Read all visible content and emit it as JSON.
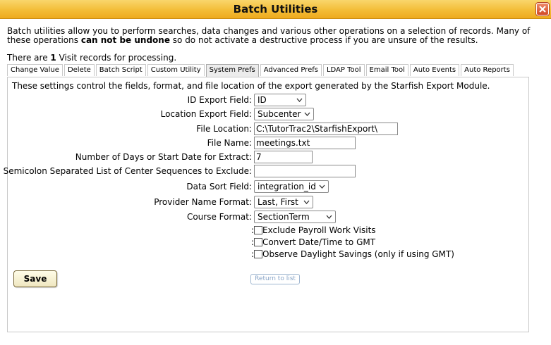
{
  "window": {
    "title": "Batch Utilities"
  },
  "intro": {
    "part1": "Batch utilities allow you to perform searches, data changes and various other operations on a selection of records. Many of these operations ",
    "bold": "can not be undone",
    "part2": " so do not activate a destructive process if you are unsure of the results."
  },
  "count": {
    "prefix": "There are ",
    "number": "1",
    "suffix": " Visit records for processing."
  },
  "tabs": [
    {
      "label": "Change Value"
    },
    {
      "label": "Delete"
    },
    {
      "label": "Batch Script"
    },
    {
      "label": "Custom Utility"
    },
    {
      "label": "System Prefs"
    },
    {
      "label": "Advanced Prefs"
    },
    {
      "label": "LDAP Tool"
    },
    {
      "label": "Email Tool"
    },
    {
      "label": "Auto Events"
    },
    {
      "label": "Auto Reports"
    }
  ],
  "active_tab": "System Prefs",
  "panel": {
    "description": "These settings control the fields, format, and file location of the export generated by the Starfish Export Module.",
    "fields": {
      "id_export": {
        "label": "ID Export Field:",
        "value": "ID"
      },
      "location_export": {
        "label": "Location Export Field:",
        "value": "Subcenter"
      },
      "file_location": {
        "label": "File Location:",
        "value": "C:\\TutorTrac2\\StarfishExport\\"
      },
      "file_name": {
        "label": "File Name:",
        "value": "meetings.txt"
      },
      "days": {
        "label": "Number of Days or Start Date for Extract:",
        "value": "7"
      },
      "exclude_centers": {
        "label": "Semicolon Separated List of Center Sequences to Exclude:",
        "value": ""
      },
      "sort_field": {
        "label": "Data Sort Field:",
        "value": "integration_id"
      },
      "provider_format": {
        "label": "Provider Name Format:",
        "value": "Last, First"
      },
      "course_format": {
        "label": "Course Format:",
        "value": "SectionTerm"
      }
    },
    "checkboxes": [
      {
        "label": "Exclude Payroll Work Visits",
        "checked": false
      },
      {
        "label": "Convert Date/Time to GMT",
        "checked": false
      },
      {
        "label": "Observe Daylight Savings (only if using GMT)",
        "checked": false
      }
    ],
    "checkbox_prefix": ":",
    "save_label": "Save",
    "return_label": "Return to list"
  }
}
